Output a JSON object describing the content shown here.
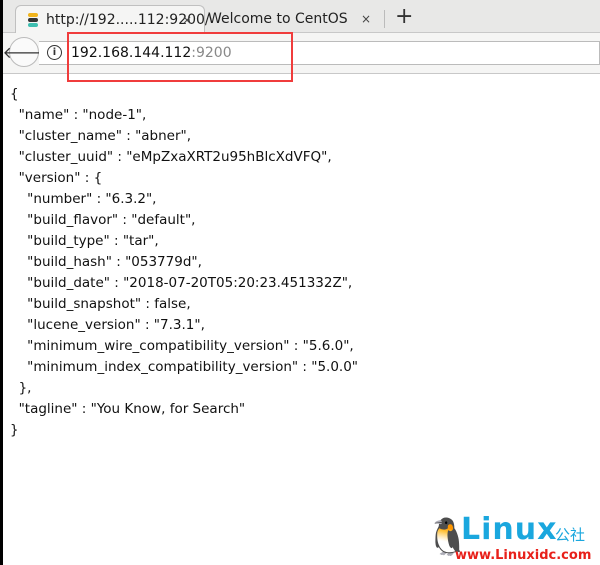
{
  "tabs": [
    {
      "label": "http://192.....112:9200/",
      "active": true
    },
    {
      "label": "Welcome to CentOS",
      "active": false
    }
  ],
  "icons": {
    "close": "×",
    "new_tab": "+",
    "back": "🡐",
    "info": "i"
  },
  "address": {
    "host": "192.168.144.112",
    "port": ":9200"
  },
  "json_lines": [
    "{",
    "  \"name\" : \"node-1\",",
    "  \"cluster_name\" : \"abner\",",
    "  \"cluster_uuid\" : \"eMpZxaXRT2u95hBlcXdVFQ\",",
    "  \"version\" : {",
    "    \"number\" : \"6.3.2\",",
    "    \"build_flavor\" : \"default\",",
    "    \"build_type\" : \"tar\",",
    "    \"build_hash\" : \"053779d\",",
    "    \"build_date\" : \"2018-07-20T05:20:23.451332Z\",",
    "    \"build_snapshot\" : false,",
    "    \"lucene_version\" : \"7.3.1\",",
    "    \"minimum_wire_compatibility_version\" : \"5.6.0\",",
    "    \"minimum_index_compatibility_version\" : \"5.0.0\"",
    "  },",
    "  \"tagline\" : \"You Know, for Search\"",
    "}"
  ],
  "watermark": {
    "brand": "Linux",
    "cn": "公社",
    "url": "www.Linuxidc.com"
  }
}
